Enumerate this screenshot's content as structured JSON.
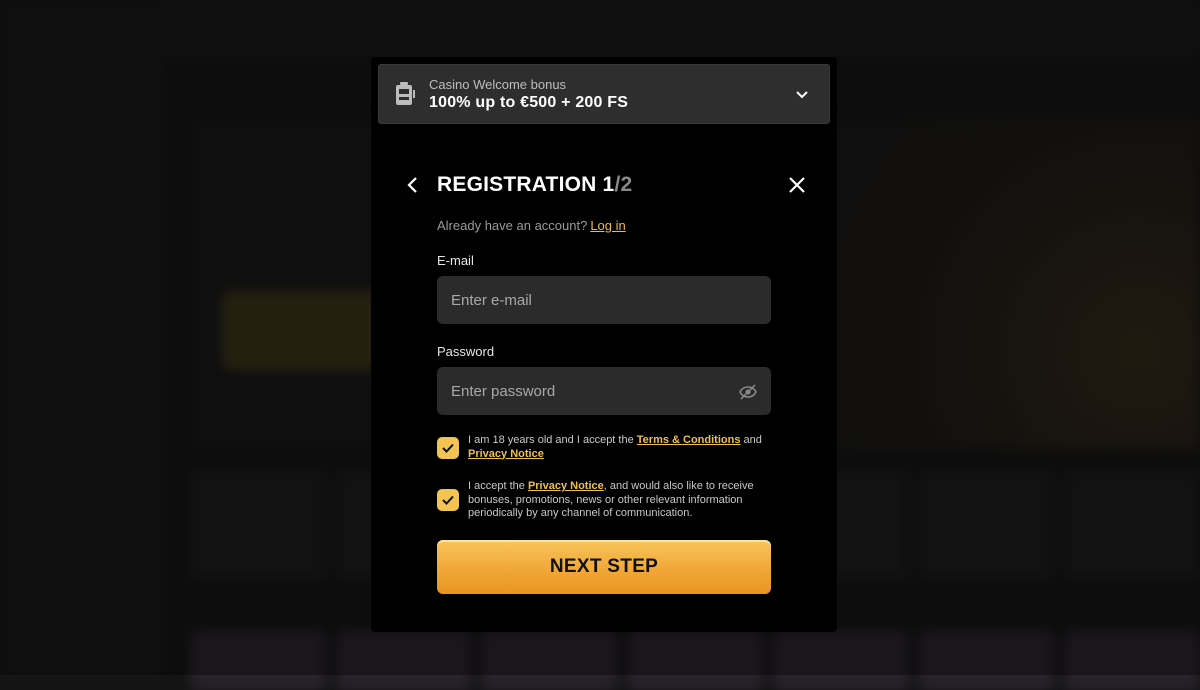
{
  "bonus": {
    "icon": "slot-machine-icon",
    "subtitle": "Casino Welcome bonus",
    "title": "100% up to €500 + 200 FS"
  },
  "header": {
    "title": "REGISTRATION 1",
    "step_total": "/2"
  },
  "login": {
    "prompt": "Already have an account?",
    "link": "Log in"
  },
  "form": {
    "email_label": "E-mail",
    "email_placeholder": "Enter e-mail",
    "email_value": "",
    "password_label": "Password",
    "password_placeholder": "Enter password",
    "password_value": ""
  },
  "consents": [
    {
      "checked": true,
      "text1": "I am 18 years old and I accept the ",
      "link1": "Terms & Conditions",
      "text2": " and ",
      "link2": "Privacy Notice"
    },
    {
      "checked": true,
      "text1": "I accept the ",
      "link1": "Privacy Notice",
      "text2": ", and would also like to receive bonuses, promotions, news or other relevant information periodically by any channel of communication."
    }
  ],
  "next_label": "NEXT STEP",
  "colors": {
    "accent": "#f4c451",
    "button": "#f0a535",
    "modal_bg": "#000000",
    "field_bg": "#2b2b2b"
  }
}
